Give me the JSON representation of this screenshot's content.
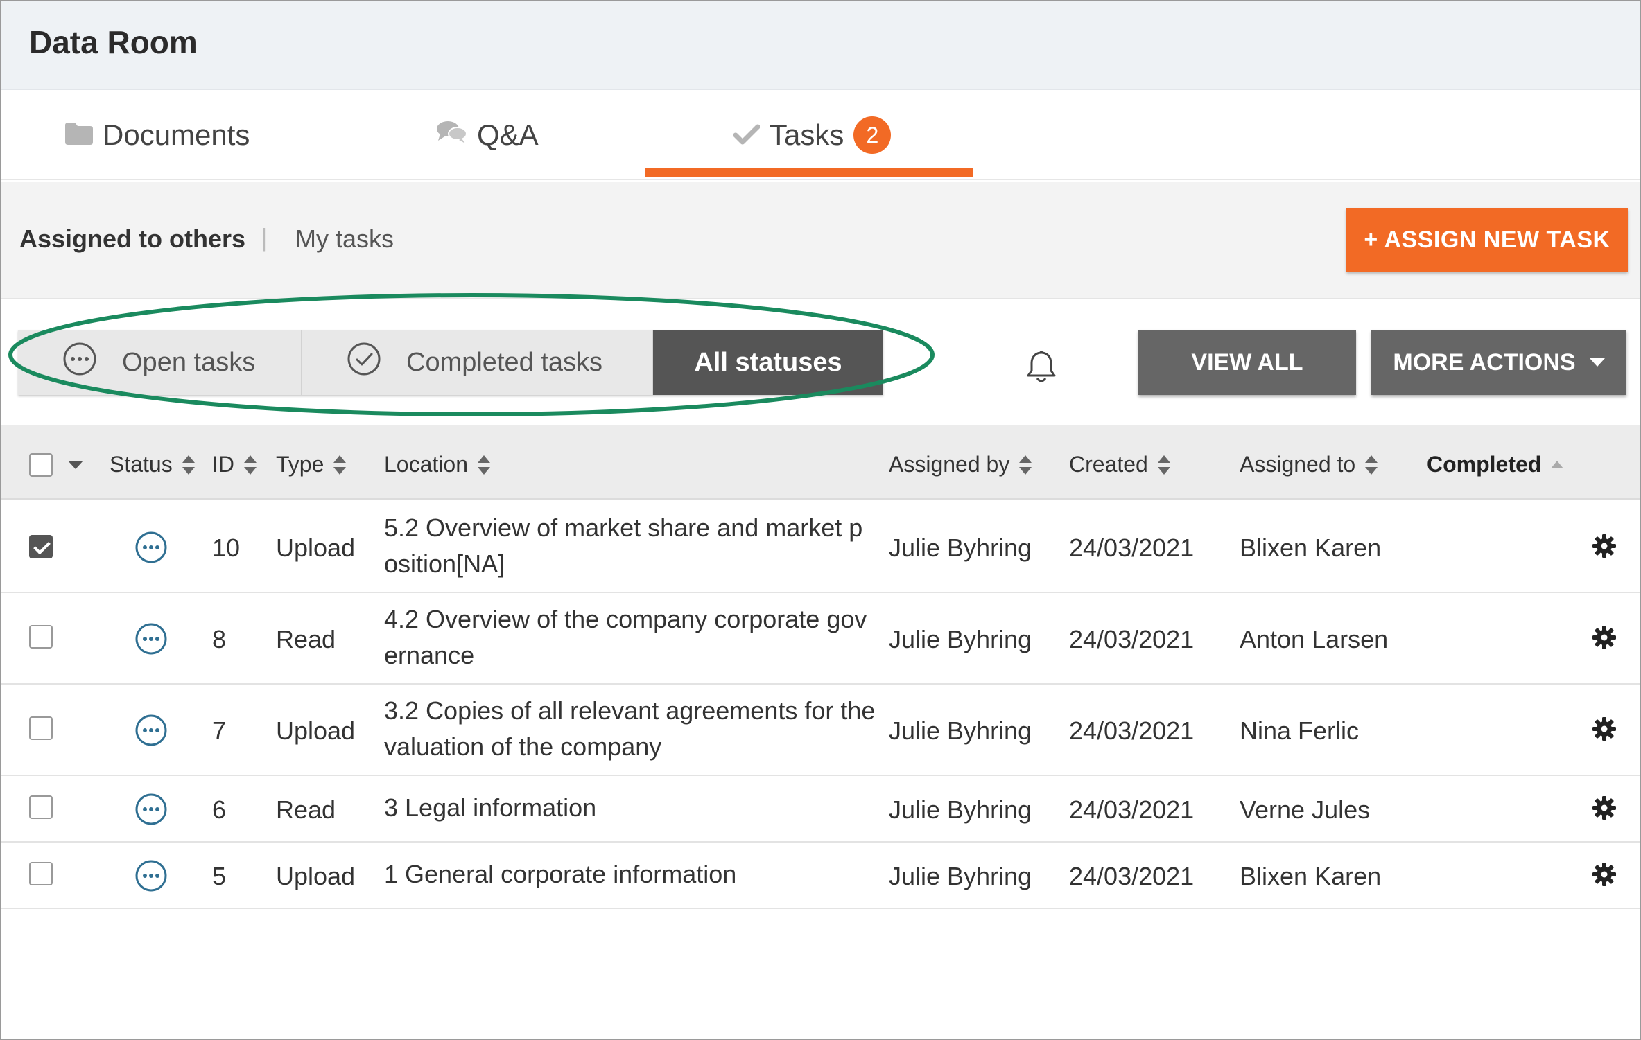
{
  "app": {
    "title": "Data Room"
  },
  "tabs": [
    {
      "label": "Documents",
      "icon": "folder-icon"
    },
    {
      "label": "Q&A",
      "icon": "chat-icon"
    },
    {
      "label": "Tasks",
      "icon": "check-icon",
      "badge": "2",
      "active": true
    }
  ],
  "subtabs": {
    "assigned": "Assigned to others",
    "separator": "|",
    "mytasks": "My tasks"
  },
  "assign_button": "+ ASSIGN NEW TASK",
  "filters": {
    "open": "Open tasks",
    "completed": "Completed tasks",
    "all": "All statuses"
  },
  "view_all": "VIEW ALL",
  "more_actions": "MORE ACTIONS",
  "columns": {
    "status": "Status",
    "id": "ID",
    "type": "Type",
    "location": "Location",
    "assigned_by": "Assigned by",
    "created": "Created",
    "assigned_to": "Assigned to",
    "completed": "Completed"
  },
  "rows": [
    {
      "id": "10",
      "type": "Upload",
      "location": "5.2 Overview of market share and market position[NA]",
      "assigned_by": "Julie Byhring",
      "created": "24/03/2021",
      "assigned_to": "Blixen Karen",
      "checked": true
    },
    {
      "id": "8",
      "type": "Read",
      "location": "4.2 Overview of the company corporate governance",
      "assigned_by": "Julie Byhring",
      "created": "24/03/2021",
      "assigned_to": "Anton Larsen",
      "checked": false
    },
    {
      "id": "7",
      "type": "Upload",
      "location": "3.2 Copies of all relevant agreements for the valuation of the company",
      "assigned_by": "Julie Byhring",
      "created": "24/03/2021",
      "assigned_to": "Nina Ferlic",
      "checked": false
    },
    {
      "id": "6",
      "type": "Read",
      "location": "3 Legal information",
      "assigned_by": "Julie Byhring",
      "created": "24/03/2021",
      "assigned_to": "Verne Jules",
      "checked": false
    },
    {
      "id": "5",
      "type": "Upload",
      "location": "1 General corporate information",
      "assigned_by": "Julie Byhring",
      "created": "24/03/2021",
      "assigned_to": "Blixen Karen",
      "checked": false
    }
  ],
  "colors": {
    "accent": "#f26a25",
    "highlight": "#1a8a5e",
    "dark_button": "#666666",
    "status_icon": "#2f6f92"
  }
}
